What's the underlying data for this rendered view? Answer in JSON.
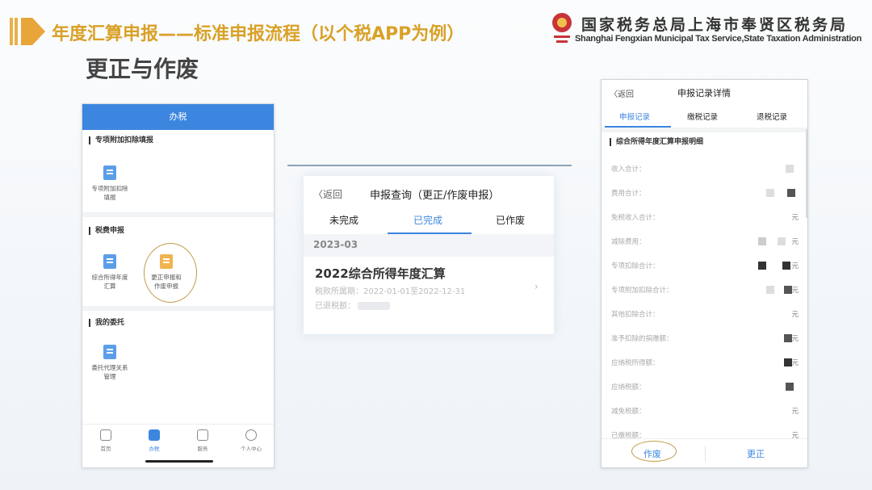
{
  "slide": {
    "title": "年度汇算申报——标准申报流程（以个税APP为例）",
    "section": "更正与作废",
    "org_cn": "国家税务总局上海市奉贤区税务局",
    "org_en": "Shanghai Fengxian Municipal Tax Service,State Taxation Administration"
  },
  "phone1": {
    "header": "办税",
    "sections": [
      {
        "title": "专项附加扣除填报",
        "tiles": [
          {
            "label_l1": "专项附加扣除",
            "label_l2": "填报",
            "icon": "deduction-form-icon",
            "color": "blue"
          }
        ]
      },
      {
        "title": "税费申报",
        "tiles": [
          {
            "label_l1": "综合所得年度",
            "label_l2": "汇算",
            "icon": "annual-settlement-icon",
            "color": "blue"
          },
          {
            "label_l1": "更正申报和",
            "label_l2": "作废申报",
            "icon": "correction-icon",
            "color": "orange"
          }
        ]
      },
      {
        "title": "我的委托",
        "tiles": [
          {
            "label_l1": "委托代理关系",
            "label_l2": "管理",
            "icon": "delegation-icon",
            "color": "blue"
          }
        ]
      }
    ],
    "nav": [
      {
        "label": "首页",
        "icon": "home-icon"
      },
      {
        "label": "办税",
        "icon": "tax-service-icon",
        "active": true
      },
      {
        "label": "服务",
        "icon": "heart-service-icon"
      },
      {
        "label": "个人中心",
        "icon": "user-icon"
      }
    ]
  },
  "middle": {
    "back": "〈返回",
    "title": "申报查询（更正/作废申报）",
    "tabs": [
      "未完成",
      "已完成",
      "已作废"
    ],
    "active_tab": "已完成",
    "date": "2023-03",
    "item_title": "2022综合所得年度汇算",
    "item_period": "税款所属期：2022-01-01至2022-12-31",
    "item_status_label": "已退税额："
  },
  "phone3": {
    "back": "〈返回",
    "title": "申报记录详情",
    "tabs": [
      "申报记录",
      "缴税记录",
      "退税记录"
    ],
    "section_title": "综合所得年度汇算申报明细",
    "rows": [
      {
        "label": "收入合计：",
        "unit": ""
      },
      {
        "label": "费用合计：",
        "unit": ""
      },
      {
        "label": "免税收入合计：",
        "unit": "元"
      },
      {
        "label": "减除费用：",
        "unit": "元"
      },
      {
        "label": "专项扣除合计：",
        "unit": "元"
      },
      {
        "label": "专项附加扣除合计：",
        "unit": "元"
      },
      {
        "label": "其他扣除合计：",
        "unit": "元"
      },
      {
        "label": "准予扣除的捐赠额：",
        "unit": "元"
      },
      {
        "label": "应纳税所得额：",
        "unit": "元"
      },
      {
        "label": "应纳税额：",
        "unit": ""
      },
      {
        "label": "减免税额：",
        "unit": "元"
      },
      {
        "label": "已缴税额：",
        "unit": "元"
      }
    ],
    "void_button": "作废",
    "correct_button": "更正"
  },
  "colors": {
    "accent": "#3d86e0",
    "title_gold": "#d9a128",
    "highlight_ring": "#c29a4a"
  }
}
